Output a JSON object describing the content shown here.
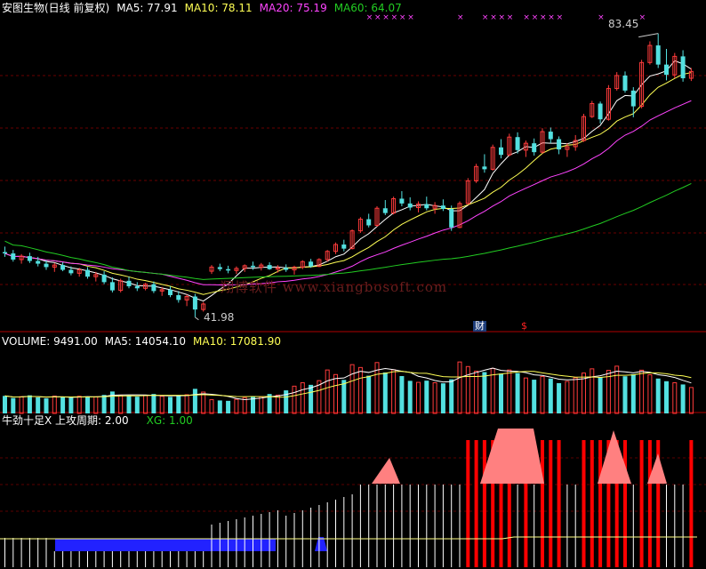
{
  "header": {
    "title": "安图生物(日线 前复权)",
    "ma5_label": "MA5: 77.91",
    "ma10_label": "MA10: 78.11",
    "ma20_label": "MA20: 75.19",
    "ma60_label": "MA60: 64.07"
  },
  "volume_header": {
    "title": "VOLUME: 9491.00",
    "ma5_label": "MA5: 14054.10",
    "ma10_label": "MA10: 17081.90"
  },
  "indicator_header": {
    "title": "牛劲十足X 上攻周期: 2.00",
    "xg_label": "XG: 1.00"
  },
  "annotations": {
    "high_label": "83.45",
    "low_label": "41.98",
    "finance_badge": "财",
    "dollar_badge": "$"
  },
  "watermark": "翔博软件 www.xiangbosoft.com",
  "colors": {
    "background": "#000000",
    "up": "#ff3b3b",
    "down": "#53e0e0",
    "ma5": "#ffffff",
    "ma10": "#ffff55",
    "ma20": "#ff44ff",
    "ma60": "#22cc22",
    "signal_marker": "#ff44ff",
    "indicator_bar": "#ff0000",
    "indicator_area": "#ff8080",
    "indicator_base": "#2222ff"
  },
  "chart_data": [
    {
      "type": "candlestick",
      "title": "安图生物(日线 前复权)",
      "ylim": [
        40,
        86
      ],
      "annotations": [
        {
          "label": "83.45",
          "type": "high"
        },
        {
          "label": "41.98",
          "type": "low"
        }
      ],
      "ohlc": [
        [
          51.5,
          52.3,
          50.8,
          51.3
        ],
        [
          51.3,
          51.8,
          50.1,
          50.4
        ],
        [
          50.4,
          51.2,
          49.8,
          50.9
        ],
        [
          50.9,
          51.4,
          49.9,
          50.2
        ],
        [
          50.2,
          50.8,
          49.4,
          49.8
        ],
        [
          49.8,
          50.3,
          48.9,
          49.3
        ],
        [
          49.3,
          49.9,
          48.6,
          49.6
        ],
        [
          49.6,
          50.0,
          48.7,
          48.9
        ],
        [
          48.9,
          49.4,
          48.1,
          48.4
        ],
        [
          48.4,
          49.2,
          47.9,
          48.9
        ],
        [
          48.9,
          49.3,
          47.6,
          47.9
        ],
        [
          47.9,
          48.6,
          47.2,
          48.2
        ],
        [
          48.2,
          48.7,
          46.8,
          47.1
        ],
        [
          47.1,
          47.8,
          45.6,
          45.9
        ],
        [
          45.9,
          47.6,
          45.6,
          47.3
        ],
        [
          47.3,
          47.9,
          46.2,
          46.5
        ],
        [
          46.5,
          47.1,
          45.8,
          46.2
        ],
        [
          46.2,
          47.0,
          45.9,
          46.8
        ],
        [
          46.8,
          47.2,
          45.5,
          45.8
        ],
        [
          45.8,
          46.4,
          45.1,
          46.0
        ],
        [
          46.0,
          46.5,
          44.9,
          45.2
        ],
        [
          45.2,
          45.8,
          44.1,
          44.5
        ],
        [
          44.5,
          45.3,
          43.6,
          45.0
        ],
        [
          45.0,
          45.4,
          41.98,
          43.1
        ],
        [
          43.1,
          44.2,
          42.8,
          43.9
        ],
        [
          48.7,
          49.6,
          48.3,
          49.3
        ],
        [
          49.3,
          49.8,
          48.7,
          49.0
        ],
        [
          49.0,
          49.5,
          48.4,
          48.8
        ],
        [
          48.8,
          49.4,
          48.3,
          49.1
        ],
        [
          49.1,
          49.7,
          48.6,
          49.5
        ],
        [
          49.5,
          50.1,
          48.9,
          49.3
        ],
        [
          49.3,
          49.9,
          48.8,
          49.6
        ],
        [
          49.6,
          50.0,
          48.9,
          49.0
        ],
        [
          49.0,
          49.6,
          48.5,
          49.2
        ],
        [
          49.2,
          49.7,
          48.6,
          48.9
        ],
        [
          48.9,
          49.5,
          48.2,
          49.3
        ],
        [
          49.3,
          50.3,
          49.0,
          50.1
        ],
        [
          50.1,
          50.5,
          49.2,
          49.4
        ],
        [
          49.4,
          50.6,
          49.3,
          50.4
        ],
        [
          50.4,
          51.8,
          50.1,
          51.6
        ],
        [
          51.6,
          52.9,
          51.2,
          52.6
        ],
        [
          52.6,
          53.3,
          51.6,
          52.0
        ],
        [
          52.0,
          54.8,
          51.9,
          54.6
        ],
        [
          54.6,
          56.6,
          54.3,
          56.3
        ],
        [
          56.3,
          57.1,
          55.1,
          55.4
        ],
        [
          55.4,
          58.2,
          55.2,
          57.9
        ],
        [
          57.9,
          59.1,
          56.9,
          57.2
        ],
        [
          57.2,
          59.6,
          57.0,
          59.3
        ],
        [
          59.3,
          60.4,
          58.2,
          58.6
        ],
        [
          58.6,
          59.5,
          57.6,
          58.0
        ],
        [
          58.0,
          58.9,
          57.3,
          58.5
        ],
        [
          58.5,
          59.6,
          57.6,
          57.9
        ],
        [
          57.9,
          58.8,
          57.1,
          58.3
        ],
        [
          58.3,
          59.2,
          57.5,
          57.8
        ],
        [
          57.8,
          58.3,
          54.6,
          55.1
        ],
        [
          55.1,
          58.9,
          55.0,
          58.6
        ],
        [
          58.6,
          62.3,
          58.4,
          61.9
        ],
        [
          61.9,
          64.4,
          61.6,
          64.0
        ],
        [
          64.0,
          65.8,
          63.1,
          63.6
        ],
        [
          63.6,
          67.2,
          63.4,
          66.8
        ],
        [
          66.8,
          68.0,
          65.2,
          65.7
        ],
        [
          65.7,
          68.8,
          65.5,
          68.3
        ],
        [
          68.3,
          69.0,
          65.9,
          66.4
        ],
        [
          66.4,
          67.8,
          65.4,
          67.4
        ],
        [
          67.4,
          68.1,
          65.6,
          66.1
        ],
        [
          66.1,
          69.6,
          65.9,
          69.1
        ],
        [
          69.1,
          69.7,
          67.4,
          68.0
        ],
        [
          68.0,
          68.4,
          65.8,
          66.5
        ],
        [
          66.5,
          67.4,
          65.4,
          66.9
        ],
        [
          66.9,
          68.6,
          66.3,
          67.8
        ],
        [
          67.8,
          71.7,
          67.6,
          71.3
        ],
        [
          71.3,
          73.6,
          71.1,
          73.2
        ],
        [
          73.2,
          73.5,
          70.3,
          70.9
        ],
        [
          70.9,
          75.9,
          70.7,
          75.4
        ],
        [
          75.4,
          77.8,
          75.1,
          77.3
        ],
        [
          77.3,
          77.9,
          74.8,
          75.1
        ],
        [
          75.1,
          75.6,
          71.2,
          72.8
        ],
        [
          72.8,
          79.6,
          72.5,
          79.2
        ],
        [
          79.2,
          82.3,
          78.9,
          81.7
        ],
        [
          81.7,
          83.45,
          78.4,
          78.9
        ],
        [
          78.9,
          81.2,
          76.6,
          77.4
        ],
        [
          77.4,
          80.6,
          76.9,
          80.1
        ],
        [
          80.1,
          81.0,
          76.4,
          76.9
        ],
        [
          76.9,
          78.4,
          76.5,
          77.9
        ]
      ]
    },
    {
      "type": "bar",
      "title": "VOLUME: 9491.00",
      "ylim": [
        0,
        35000
      ],
      "values": [
        9200,
        8100,
        8800,
        9500,
        8400,
        7900,
        9100,
        8600,
        8300,
        9000,
        8900,
        8700,
        9700,
        11500,
        9600,
        9200,
        8800,
        9400,
        10200,
        9000,
        8700,
        9100,
        9800,
        12900,
        11200,
        7200,
        6800,
        6600,
        7400,
        8300,
        9100,
        8700,
        10200,
        9600,
        12100,
        14300,
        16100,
        15000,
        17200,
        22800,
        20400,
        17600,
        25600,
        24100,
        19800,
        26700,
        21500,
        22900,
        19600,
        17100,
        16300,
        17200,
        16100,
        15800,
        17900,
        27000,
        24600,
        22200,
        21700,
        23600,
        20900,
        22800,
        21200,
        18600,
        17700,
        19400,
        18300,
        15900,
        16800,
        18700,
        21200,
        23400,
        18900,
        22600,
        24800,
        19500,
        20600,
        22700,
        20300,
        18300,
        16900,
        16100,
        15200,
        13600
      ],
      "ma5_label": "MA5: 14054.10",
      "ma10_label": "MA10: 17081.90"
    },
    {
      "type": "bar",
      "title": "牛劲十足X 上攻周期: 2.00",
      "series": [
        {
          "name": "XG",
          "value_label": "XG: 1.00"
        }
      ]
    }
  ]
}
